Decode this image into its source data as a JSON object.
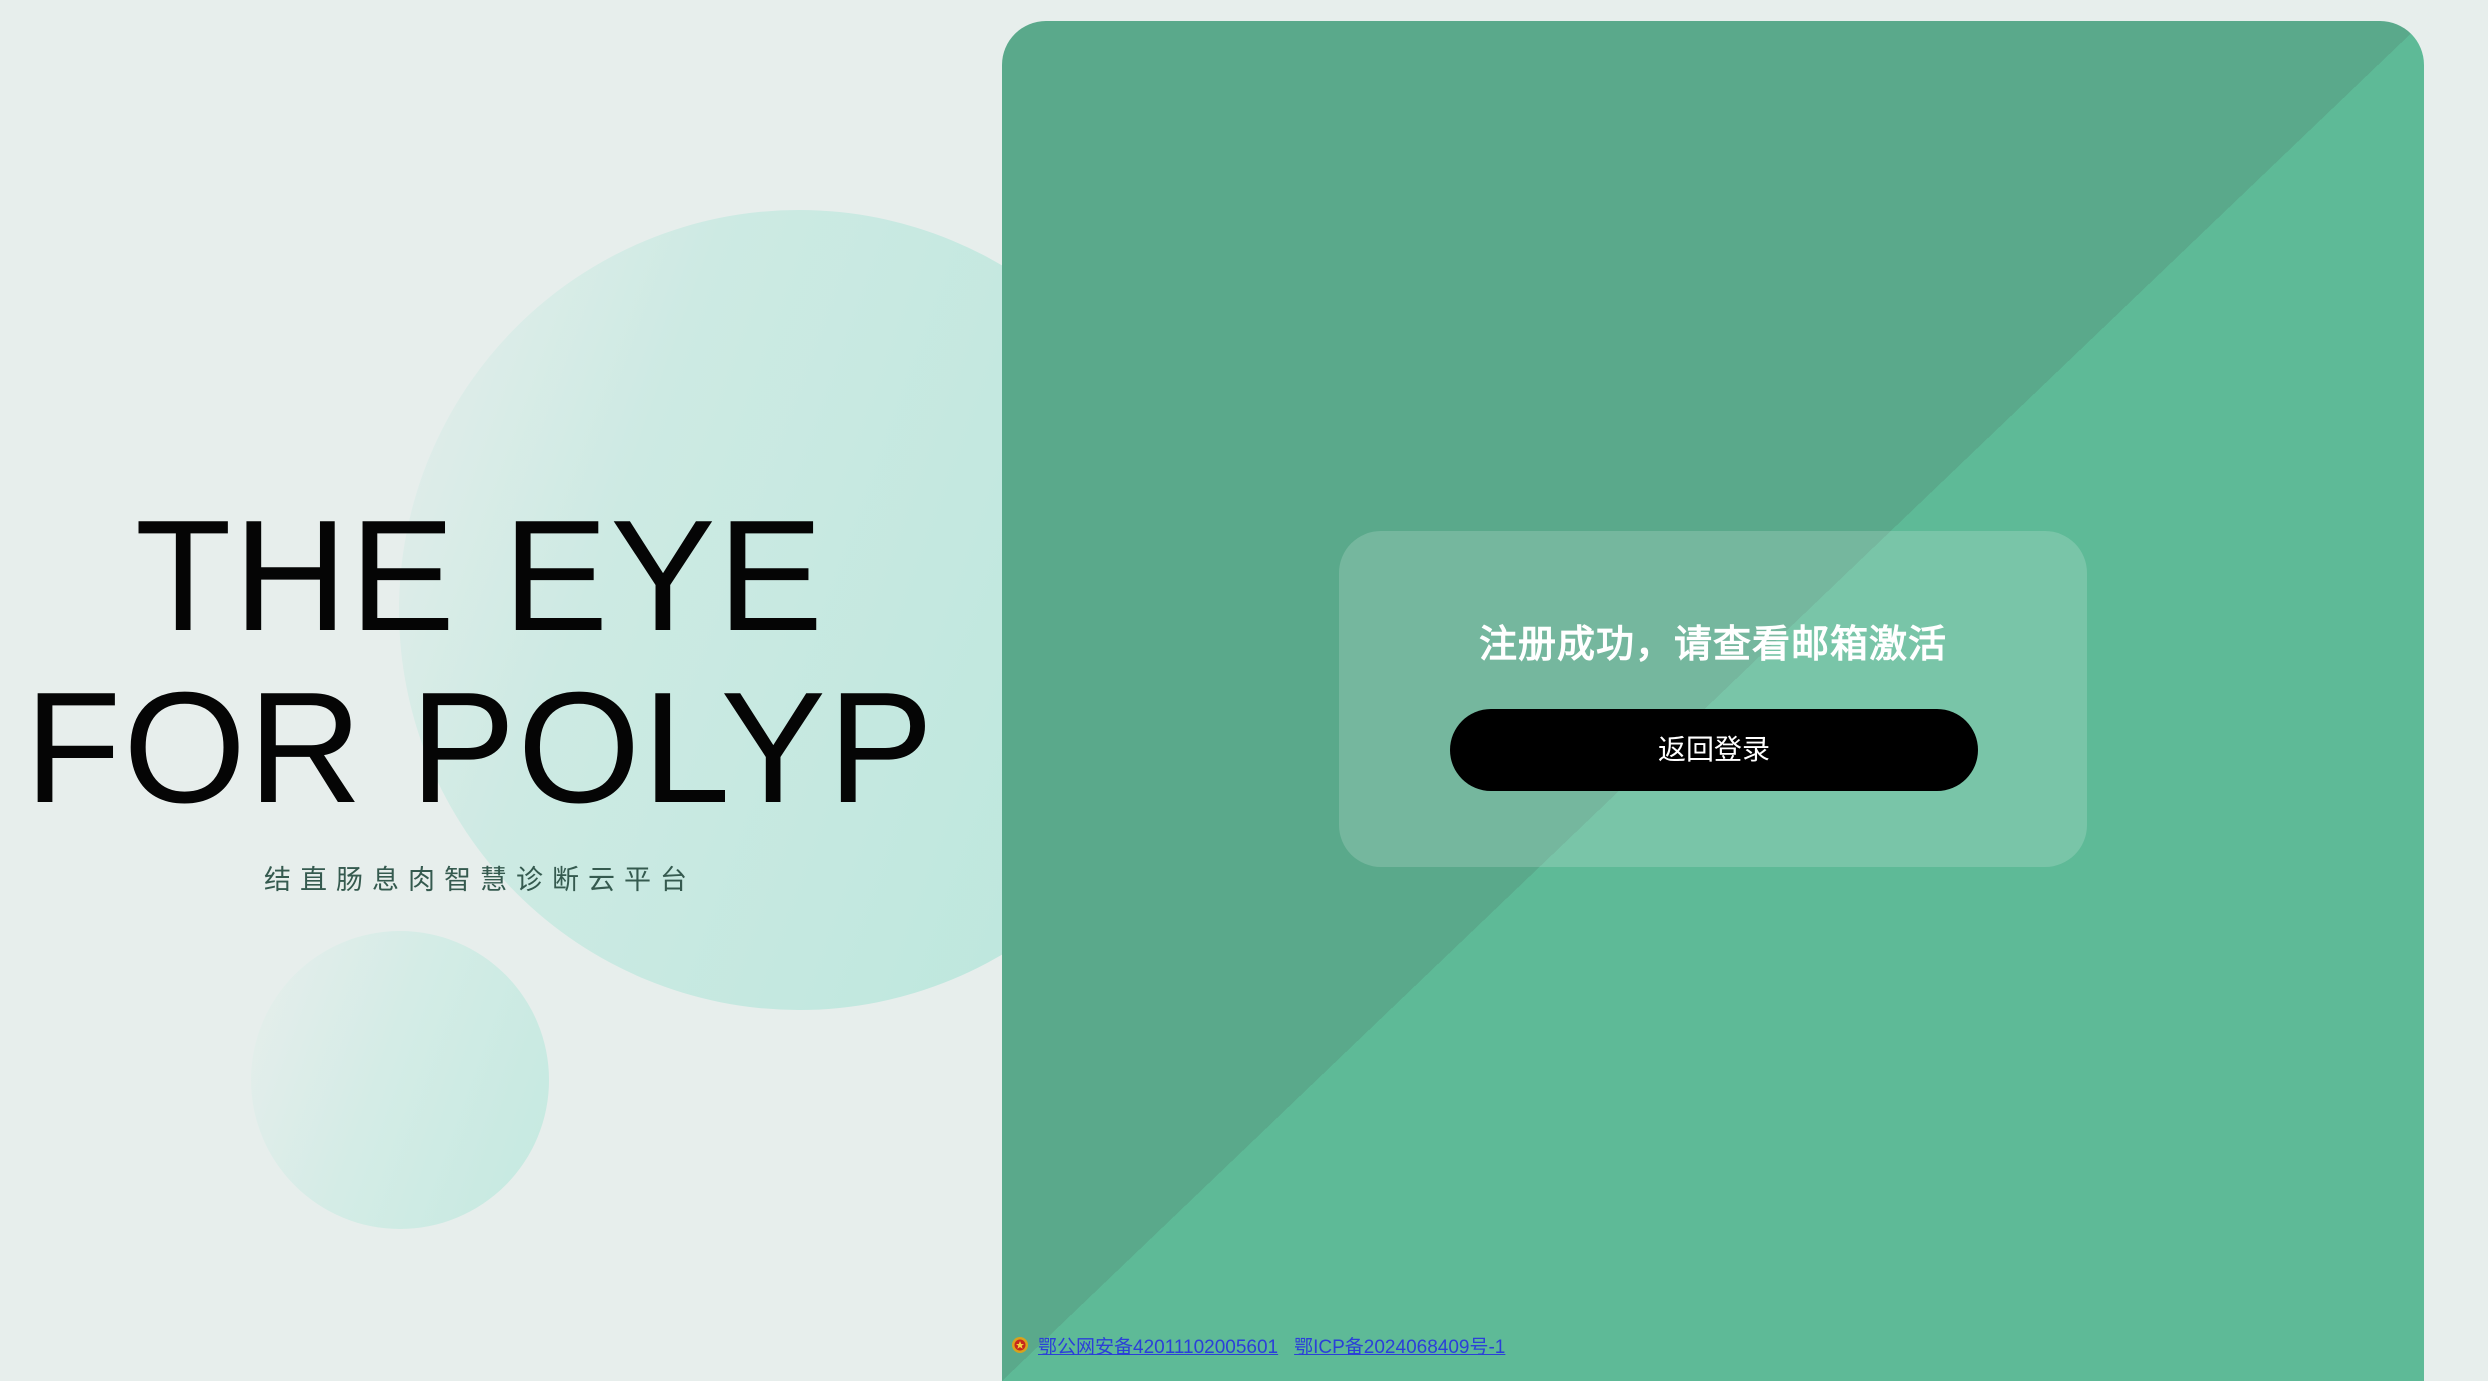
{
  "hero": {
    "line1": "THE EYE",
    "line2": "FOR POLYP",
    "subtitle": "结直肠息肉智慧诊断云平台"
  },
  "card": {
    "message": "注册成功，请查看邮箱激活",
    "button_label": "返回登录"
  },
  "footer": {
    "police_record": "鄂公网安备42011102005601",
    "icp_record": "鄂ICP备2024068409号-1",
    "police_icon": "police-badge-icon"
  },
  "colors": {
    "background": "#e7eeec",
    "panel_dark": "#5aa98b",
    "panel_light": "#5eba97",
    "button": "#000000",
    "link": "#2b3fd8"
  }
}
